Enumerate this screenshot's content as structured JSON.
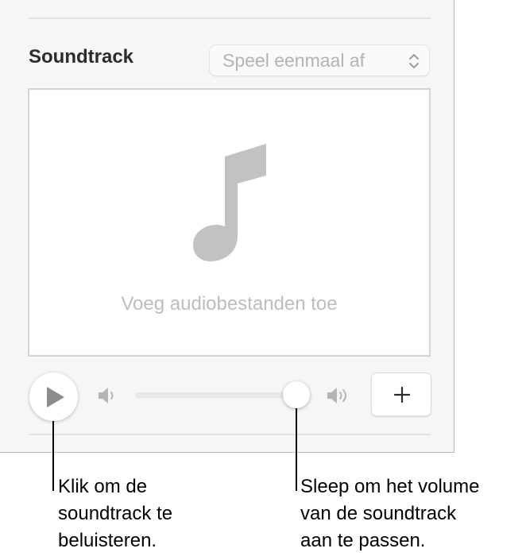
{
  "panel": {
    "section_title": "Soundtrack",
    "playback_mode": {
      "selected": "Speel eenmaal af",
      "icon": "chevron-updown-icon"
    },
    "dropzone": {
      "icon": "music-note-icon",
      "hint": "Voeg audiobestanden toe"
    },
    "controls": {
      "play_icon": "play-icon",
      "volume_low_icon": "speaker-low-icon",
      "volume_high_icon": "speaker-high-icon",
      "volume_level": 0.97,
      "add_icon": "plus-icon"
    }
  },
  "callouts": {
    "play": "Klik om de\nsoundtrack te\nbeluisteren.",
    "volume": "Sleep om het volume\nvan de soundtrack\naan te passen."
  },
  "colors": {
    "panel_bg": "#f6f6f6",
    "placeholder_text": "#bdbdbd",
    "icon_gray": "#9c9c9c"
  }
}
